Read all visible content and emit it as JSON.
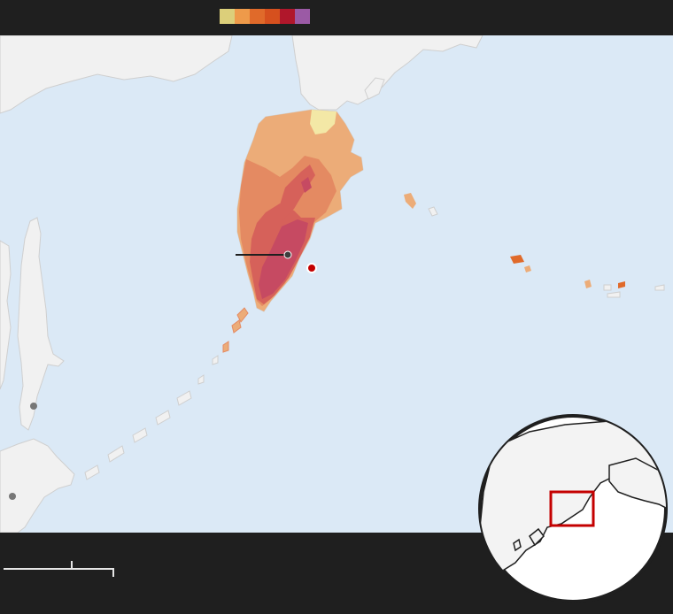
{
  "legend": {
    "intensity_colors": [
      "#dccf7a",
      "#ee9a4a",
      "#e06a2a",
      "#d6501e",
      "#b0172b",
      "#9b5aa5"
    ]
  },
  "map": {
    "water_color": "#dbe9f6",
    "land_color": "#f1f1f1",
    "intensity_fill_colors": {
      "light": "#f3e8a6",
      "moderate": "#ecac78",
      "strong": "#e48a62",
      "very_strong": "#d6615a",
      "severe": "#c64a62"
    },
    "epicenter_color": "#c40000",
    "city_marker_color": "#3d3d3d"
  },
  "locator": {
    "highlight_color": "#c40000"
  },
  "scale_bar": {}
}
